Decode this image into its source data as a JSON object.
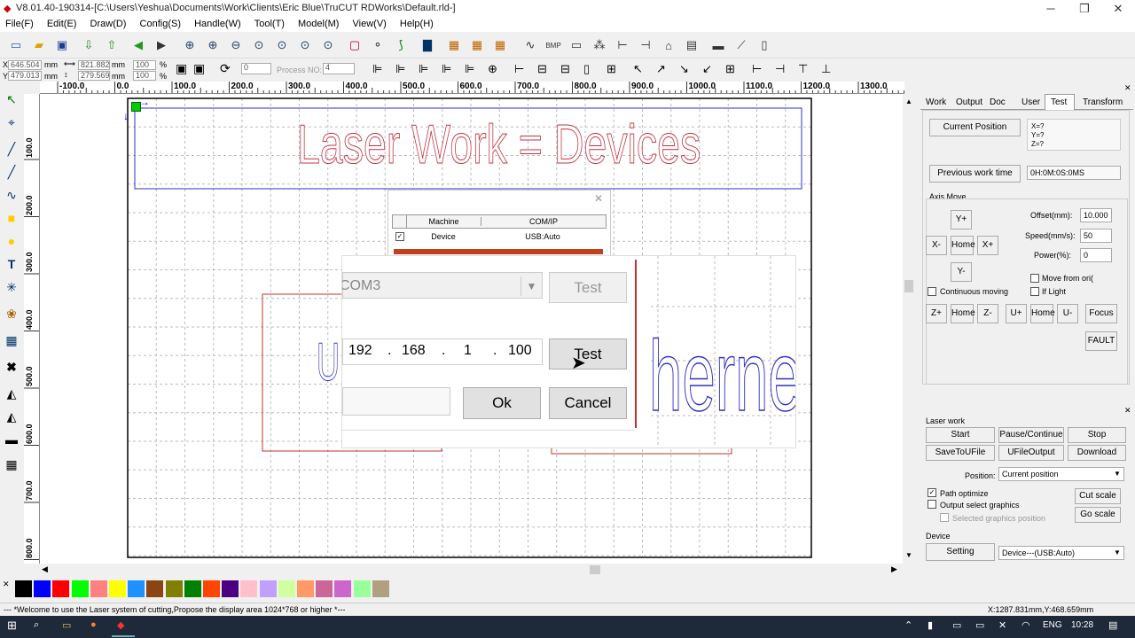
{
  "window": {
    "title": "V8.01.40-190314-[C:\\Users\\Yeshua\\Documents\\Work\\Clients\\Eric Blue\\TruCUT RDWorks\\Default.rld-]"
  },
  "menu": [
    "File(F)",
    "Edit(E)",
    "Draw(D)",
    "Config(S)",
    "Handle(W)",
    "Tool(T)",
    "Model(M)",
    "View(V)",
    "Help(H)"
  ],
  "coords": {
    "x_label": "X",
    "y_label": "Y",
    "x_val": "646.504",
    "y_val": "479.013",
    "unit": "mm",
    "w_val": "821.882",
    "h_val": "279.569",
    "pct1": "100",
    "pct2": "100",
    "pct_sign": "%",
    "rotate_val": "0",
    "process_label": "Process NO:",
    "process_val": "4"
  },
  "ruler_h": [
    "-100.0",
    "0.0",
    "100.0",
    "200.0",
    "300.0",
    "400.0",
    "500.0",
    "600.0",
    "700.0",
    "800.0",
    "900.0",
    "1000.0",
    "1100.0",
    "1200.0",
    "1300.0"
  ],
  "ruler_v": [
    "100.0",
    "200.0",
    "300.0",
    "400.0",
    "500.0",
    "600.0",
    "700.0",
    "800.0"
  ],
  "canvas": {
    "headline": "Laser Work = Devices",
    "ethernet_fragment": "herne",
    "usb_fragment": "U"
  },
  "machine_dialog": {
    "col_machine": "Machine",
    "col_comip": "COM/IP",
    "row_machine": "Device",
    "row_comip": "USB:Auto"
  },
  "connect_dialog": {
    "com_value": "COM3",
    "test_label": "Test",
    "ip": [
      "192",
      "168",
      "1",
      "100"
    ],
    "dot": ".",
    "ok_label": "Ok",
    "cancel_label": "Cancel"
  },
  "right_panel": {
    "tabs": [
      "Work",
      "Output",
      "Doc",
      "User",
      "Test",
      "Transform"
    ],
    "active_tab": "Test",
    "current_position_btn": "Current Position",
    "xyz": [
      "X=?",
      "Y=?",
      "Z=?"
    ],
    "prev_work_time_btn": "Previous work time",
    "prev_work_time_val": "0H:0M:0S:0MS",
    "axis_move_title": "Axis Move",
    "y_plus": "Y+",
    "y_minus": "Y-",
    "x_minus": "X-",
    "x_plus": "X+",
    "home": "Home",
    "offset_label": "Offset(mm):",
    "offset_val": "10.000",
    "speed_label": "Speed(mm/s):",
    "speed_val": "50",
    "power_label": "Power(%):",
    "power_val": "0",
    "move_from_origin": "Move from ori(",
    "continuous_moving": "Continuous moving",
    "if_light": "If Light",
    "z_plus": "Z+",
    "z_minus": "Z-",
    "u_plus": "U+",
    "u_minus": "U-",
    "focus": "Focus",
    "fault": "FAULT"
  },
  "laser_work": {
    "title": "Laser work",
    "start": "Start",
    "pause": "Pause/Continue",
    "stop": "Stop",
    "save_to_ufile": "SaveToUFile",
    "ufile_output": "UFileOutput",
    "download": "Download",
    "position_label": "Position:",
    "position_val": "Current position",
    "path_optimize": "Path optimize",
    "output_select": "Output select graphics",
    "selected_pos": "Selected graphics position",
    "cut_scale": "Cut scale",
    "go_scale": "Go scale"
  },
  "device": {
    "title": "Device",
    "setting": "Setting",
    "device_val": "Device---(USB:Auto)"
  },
  "palette": [
    "#000000",
    "#0000ff",
    "#ff0000",
    "#00ff00",
    "#ff8080",
    "#ffff00",
    "#1e90ff",
    "#8b4513",
    "#808000",
    "#008000",
    "#ff4500",
    "#4b0082",
    "#ffc0cb",
    "#c0a0ff",
    "#d0ffa0",
    "#ff9966",
    "#cc6699",
    "#cc66cc",
    "#99ff99",
    "#b0a080"
  ],
  "status": {
    "message": "--- *Welcome to use the Laser system of cutting,Propose the display area 1024*768 or higher *---",
    "coords": "X:1287.831mm,Y:468.659mm"
  },
  "taskbar": {
    "lang": "ENG",
    "time": "10:28"
  }
}
